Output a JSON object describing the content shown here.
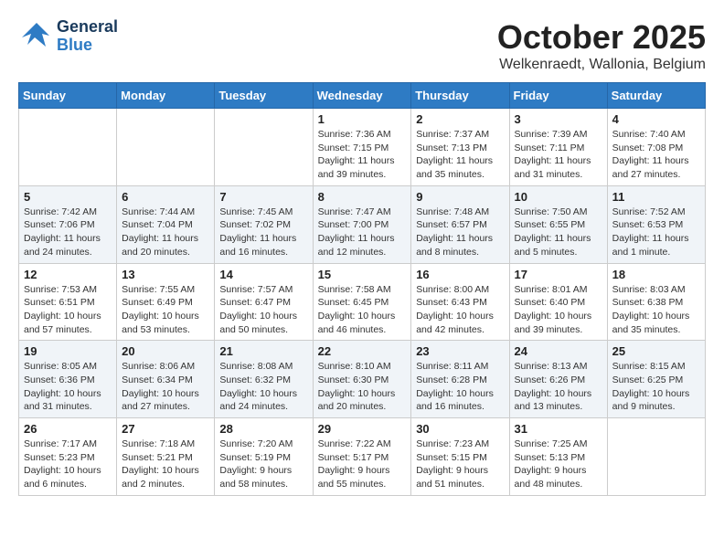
{
  "app": {
    "logo_line1": "General",
    "logo_line2": "Blue",
    "title": "October 2025",
    "subtitle": "Welkenraedt, Wallonia, Belgium"
  },
  "calendar": {
    "headers": [
      "Sunday",
      "Monday",
      "Tuesday",
      "Wednesday",
      "Thursday",
      "Friday",
      "Saturday"
    ],
    "weeks": [
      [
        {
          "day": "",
          "content": ""
        },
        {
          "day": "",
          "content": ""
        },
        {
          "day": "",
          "content": ""
        },
        {
          "day": "1",
          "content": "Sunrise: 7:36 AM\nSunset: 7:15 PM\nDaylight: 11 hours and 39 minutes."
        },
        {
          "day": "2",
          "content": "Sunrise: 7:37 AM\nSunset: 7:13 PM\nDaylight: 11 hours and 35 minutes."
        },
        {
          "day": "3",
          "content": "Sunrise: 7:39 AM\nSunset: 7:11 PM\nDaylight: 11 hours and 31 minutes."
        },
        {
          "day": "4",
          "content": "Sunrise: 7:40 AM\nSunset: 7:08 PM\nDaylight: 11 hours and 27 minutes."
        }
      ],
      [
        {
          "day": "5",
          "content": "Sunrise: 7:42 AM\nSunset: 7:06 PM\nDaylight: 11 hours and 24 minutes."
        },
        {
          "day": "6",
          "content": "Sunrise: 7:44 AM\nSunset: 7:04 PM\nDaylight: 11 hours and 20 minutes."
        },
        {
          "day": "7",
          "content": "Sunrise: 7:45 AM\nSunset: 7:02 PM\nDaylight: 11 hours and 16 minutes."
        },
        {
          "day": "8",
          "content": "Sunrise: 7:47 AM\nSunset: 7:00 PM\nDaylight: 11 hours and 12 minutes."
        },
        {
          "day": "9",
          "content": "Sunrise: 7:48 AM\nSunset: 6:57 PM\nDaylight: 11 hours and 8 minutes."
        },
        {
          "day": "10",
          "content": "Sunrise: 7:50 AM\nSunset: 6:55 PM\nDaylight: 11 hours and 5 minutes."
        },
        {
          "day": "11",
          "content": "Sunrise: 7:52 AM\nSunset: 6:53 PM\nDaylight: 11 hours and 1 minute."
        }
      ],
      [
        {
          "day": "12",
          "content": "Sunrise: 7:53 AM\nSunset: 6:51 PM\nDaylight: 10 hours and 57 minutes."
        },
        {
          "day": "13",
          "content": "Sunrise: 7:55 AM\nSunset: 6:49 PM\nDaylight: 10 hours and 53 minutes."
        },
        {
          "day": "14",
          "content": "Sunrise: 7:57 AM\nSunset: 6:47 PM\nDaylight: 10 hours and 50 minutes."
        },
        {
          "day": "15",
          "content": "Sunrise: 7:58 AM\nSunset: 6:45 PM\nDaylight: 10 hours and 46 minutes."
        },
        {
          "day": "16",
          "content": "Sunrise: 8:00 AM\nSunset: 6:43 PM\nDaylight: 10 hours and 42 minutes."
        },
        {
          "day": "17",
          "content": "Sunrise: 8:01 AM\nSunset: 6:40 PM\nDaylight: 10 hours and 39 minutes."
        },
        {
          "day": "18",
          "content": "Sunrise: 8:03 AM\nSunset: 6:38 PM\nDaylight: 10 hours and 35 minutes."
        }
      ],
      [
        {
          "day": "19",
          "content": "Sunrise: 8:05 AM\nSunset: 6:36 PM\nDaylight: 10 hours and 31 minutes."
        },
        {
          "day": "20",
          "content": "Sunrise: 8:06 AM\nSunset: 6:34 PM\nDaylight: 10 hours and 27 minutes."
        },
        {
          "day": "21",
          "content": "Sunrise: 8:08 AM\nSunset: 6:32 PM\nDaylight: 10 hours and 24 minutes."
        },
        {
          "day": "22",
          "content": "Sunrise: 8:10 AM\nSunset: 6:30 PM\nDaylight: 10 hours and 20 minutes."
        },
        {
          "day": "23",
          "content": "Sunrise: 8:11 AM\nSunset: 6:28 PM\nDaylight: 10 hours and 16 minutes."
        },
        {
          "day": "24",
          "content": "Sunrise: 8:13 AM\nSunset: 6:26 PM\nDaylight: 10 hours and 13 minutes."
        },
        {
          "day": "25",
          "content": "Sunrise: 8:15 AM\nSunset: 6:25 PM\nDaylight: 10 hours and 9 minutes."
        }
      ],
      [
        {
          "day": "26",
          "content": "Sunrise: 7:17 AM\nSunset: 5:23 PM\nDaylight: 10 hours and 6 minutes."
        },
        {
          "day": "27",
          "content": "Sunrise: 7:18 AM\nSunset: 5:21 PM\nDaylight: 10 hours and 2 minutes."
        },
        {
          "day": "28",
          "content": "Sunrise: 7:20 AM\nSunset: 5:19 PM\nDaylight: 9 hours and 58 minutes."
        },
        {
          "day": "29",
          "content": "Sunrise: 7:22 AM\nSunset: 5:17 PM\nDaylight: 9 hours and 55 minutes."
        },
        {
          "day": "30",
          "content": "Sunrise: 7:23 AM\nSunset: 5:15 PM\nDaylight: 9 hours and 51 minutes."
        },
        {
          "day": "31",
          "content": "Sunrise: 7:25 AM\nSunset: 5:13 PM\nDaylight: 9 hours and 48 minutes."
        },
        {
          "day": "",
          "content": ""
        }
      ]
    ]
  }
}
